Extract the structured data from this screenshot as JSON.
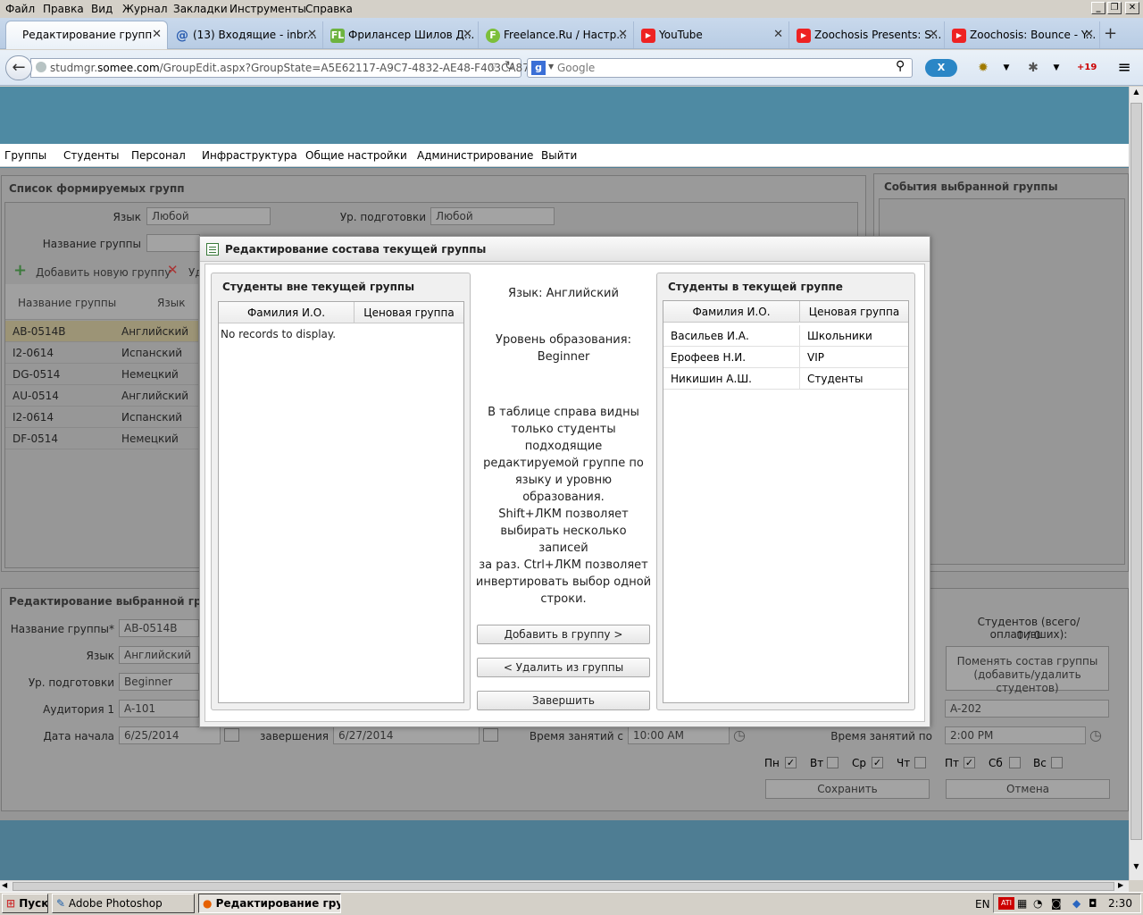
{
  "browser": {
    "menu": [
      "Файл",
      "Правка",
      "Вид",
      "Журнал",
      "Закладки",
      "Инструменты",
      "Справка"
    ],
    "tabs": [
      {
        "label": "Редактирование групп",
        "icon": "page-icon"
      },
      {
        "label": "(13) Входящие - inbr...",
        "icon": "mail-icon"
      },
      {
        "label": "Фрилансер Шилов Д...",
        "icon": "fl-icon",
        "icon_text": "FL"
      },
      {
        "label": "Freelance.Ru / Настр...",
        "icon": "freelance-icon",
        "icon_text": "F"
      },
      {
        "label": "YouTube",
        "icon": "youtube-icon"
      },
      {
        "label": "Zoochosis Presents: S...",
        "icon": "youtube-icon"
      },
      {
        "label": "Zoochosis: Bounce - Y...",
        "icon": "youtube-icon"
      }
    ],
    "url_prefix": "studmgr.",
    "url_domain": "somee.com",
    "url_path": "/GroupEdit.aspx?GroupState=A5E62117-A9C7-4832-AE48-F403CA877624",
    "search_placeholder": "Google",
    "notification_count": "+19"
  },
  "app": {
    "menu": [
      "Группы",
      "Студенты",
      "Персонал",
      "Инфраструктура",
      "Общие настройки",
      "Администрирование",
      "Выйти"
    ],
    "groups_panel": {
      "title": "Список формируемых групп",
      "language_label": "Язык",
      "language_value": "Любой",
      "level_label": "Ур. подготовки",
      "level_value": "Любой",
      "name_label": "Название группы",
      "add_button": "Добавить новую группу",
      "delete_button": "Уд",
      "columns": [
        "Название группы",
        "Язык"
      ],
      "rows": [
        {
          "name": "AB-0514B",
          "lang": "Английский"
        },
        {
          "name": "I2-0614",
          "lang": "Испанский"
        },
        {
          "name": "DG-0514",
          "lang": "Немецкий"
        },
        {
          "name": "AU-0514",
          "lang": "Английский"
        },
        {
          "name": "I2-0614",
          "lang": "Испанский"
        },
        {
          "name": "DF-0514",
          "lang": "Немецкий"
        }
      ]
    },
    "events_panel": {
      "title": "События выбранной группы"
    },
    "edit_panel": {
      "title": "Редактирование выбранной группы",
      "name_label": "Название группы*",
      "name_value": "AB-0514B",
      "lang_label": "Язык",
      "lang_value": "Английский",
      "level_label": "Ур. подготовки",
      "level_value": "Beginner",
      "room1_label": "Аудитория 1",
      "room1_value": "A-101",
      "room2_value": "A-202",
      "start_label": "Дата начала",
      "start_value": "6/25/2014",
      "end_label": "завершения",
      "end_value": "6/27/2014",
      "time_from_label": "Время занятий с",
      "time_from_value": "10:00 AM",
      "time_to_label": "Время занятий по",
      "time_to_value": "2:00 PM",
      "students_count_label": "Студентов (всего/оплативших):",
      "students_count_value": "0 / 0",
      "change_button": "Поменять состав группы (добавить/удалить студентов)",
      "days": [
        {
          "label": "Пн",
          "checked": true
        },
        {
          "label": "Вт",
          "checked": false
        },
        {
          "label": "Ср",
          "checked": true
        },
        {
          "label": "Чт",
          "checked": false
        },
        {
          "label": "Пт",
          "checked": true
        },
        {
          "label": "Сб",
          "checked": false
        },
        {
          "label": "Вс",
          "checked": false
        }
      ],
      "save_button": "Сохранить",
      "cancel_button": "Отмена"
    }
  },
  "modal": {
    "title": "Редактирование состава текущей группы",
    "left": {
      "title": "Студенты вне текущей группы",
      "columns": [
        "Фамилия И.О.",
        "Ценовая группа"
      ],
      "empty": "No records to display."
    },
    "right": {
      "title": "Студенты в текущей группе",
      "columns": [
        "Фамилия И.О.",
        "Ценовая группа"
      ],
      "rows": [
        {
          "name": "Васильев И.А.",
          "price": "Школьники"
        },
        {
          "name": "Ерофеев Н.И.",
          "price": "VIP"
        },
        {
          "name": "Никишин А.Ш.",
          "price": "Студенты"
        }
      ]
    },
    "language_text": "Язык: Английский",
    "level_text_1": "Уровень образования:",
    "level_text_2": "Beginner",
    "hint": [
      "В таблице справа видны",
      "только студенты подходящие",
      "редактируемой группе по",
      "языку и уровню образования.",
      "Shift+ЛКМ позволяет",
      "выбирать несколько записей",
      "за раз. Ctrl+ЛКМ позволяет",
      "инвертировать выбор одной",
      "строки."
    ],
    "add_button": "Добавить в группу >",
    "remove_button": "< Удалить из группы",
    "finish_button": "Завершить"
  },
  "taskbar": {
    "start": "Пуск",
    "items": [
      "Adobe Photoshop",
      "Редактирование гру..."
    ],
    "lang": "EN",
    "clock": "2:30"
  }
}
